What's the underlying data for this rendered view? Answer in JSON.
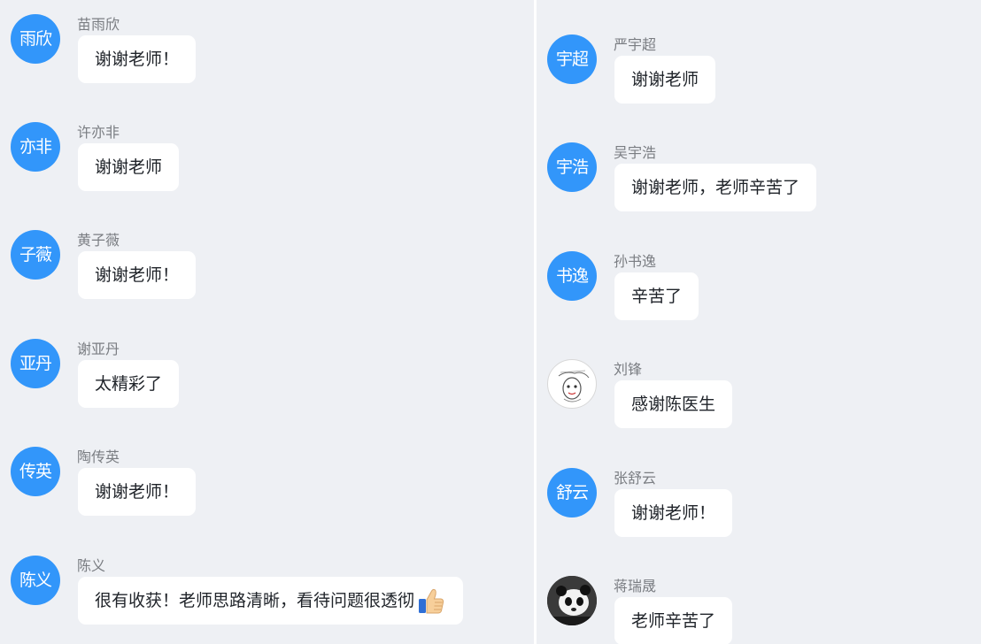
{
  "left_column": [
    {
      "avatar_text": "雨欣",
      "sender": "苗雨欣",
      "text": "谢谢老师！"
    },
    {
      "avatar_text": "亦非",
      "sender": "许亦非",
      "text": "谢谢老师"
    },
    {
      "avatar_text": "子薇",
      "sender": "黄子薇",
      "text": "谢谢老师！"
    },
    {
      "avatar_text": "亚丹",
      "sender": "谢亚丹",
      "text": "太精彩了"
    },
    {
      "avatar_text": "传英",
      "sender": "陶传英",
      "text": "谢谢老师！"
    },
    {
      "avatar_text": "陈义",
      "sender": "陈义",
      "text": "很有收获！老师思路清晰，看待问题很透彻",
      "emoji": "thumbs-up-icon"
    }
  ],
  "right_column": [
    {
      "avatar_text": "宇超",
      "sender": "严宇超",
      "text": "谢谢老师"
    },
    {
      "avatar_text": "宇浩",
      "sender": "吴宇浩",
      "text": "谢谢老师，老师辛苦了"
    },
    {
      "avatar_text": "书逸",
      "sender": "孙书逸",
      "text": "辛苦了"
    },
    {
      "avatar_text": "",
      "avatar_type": "sketch-image",
      "sender": "刘锋",
      "text": "感谢陈医生"
    },
    {
      "avatar_text": "舒云",
      "sender": "张舒云",
      "text": "谢谢老师！"
    },
    {
      "avatar_text": "",
      "avatar_type": "panda-photo",
      "sender": "蒋瑞晟",
      "text": "老师辛苦了"
    }
  ],
  "colors": {
    "avatar_bg": "#3296fa",
    "panel_bg": "#eef0f4",
    "bubble_bg": "#ffffff",
    "sender_text": "#7a7d82",
    "message_text": "#1f2329"
  }
}
